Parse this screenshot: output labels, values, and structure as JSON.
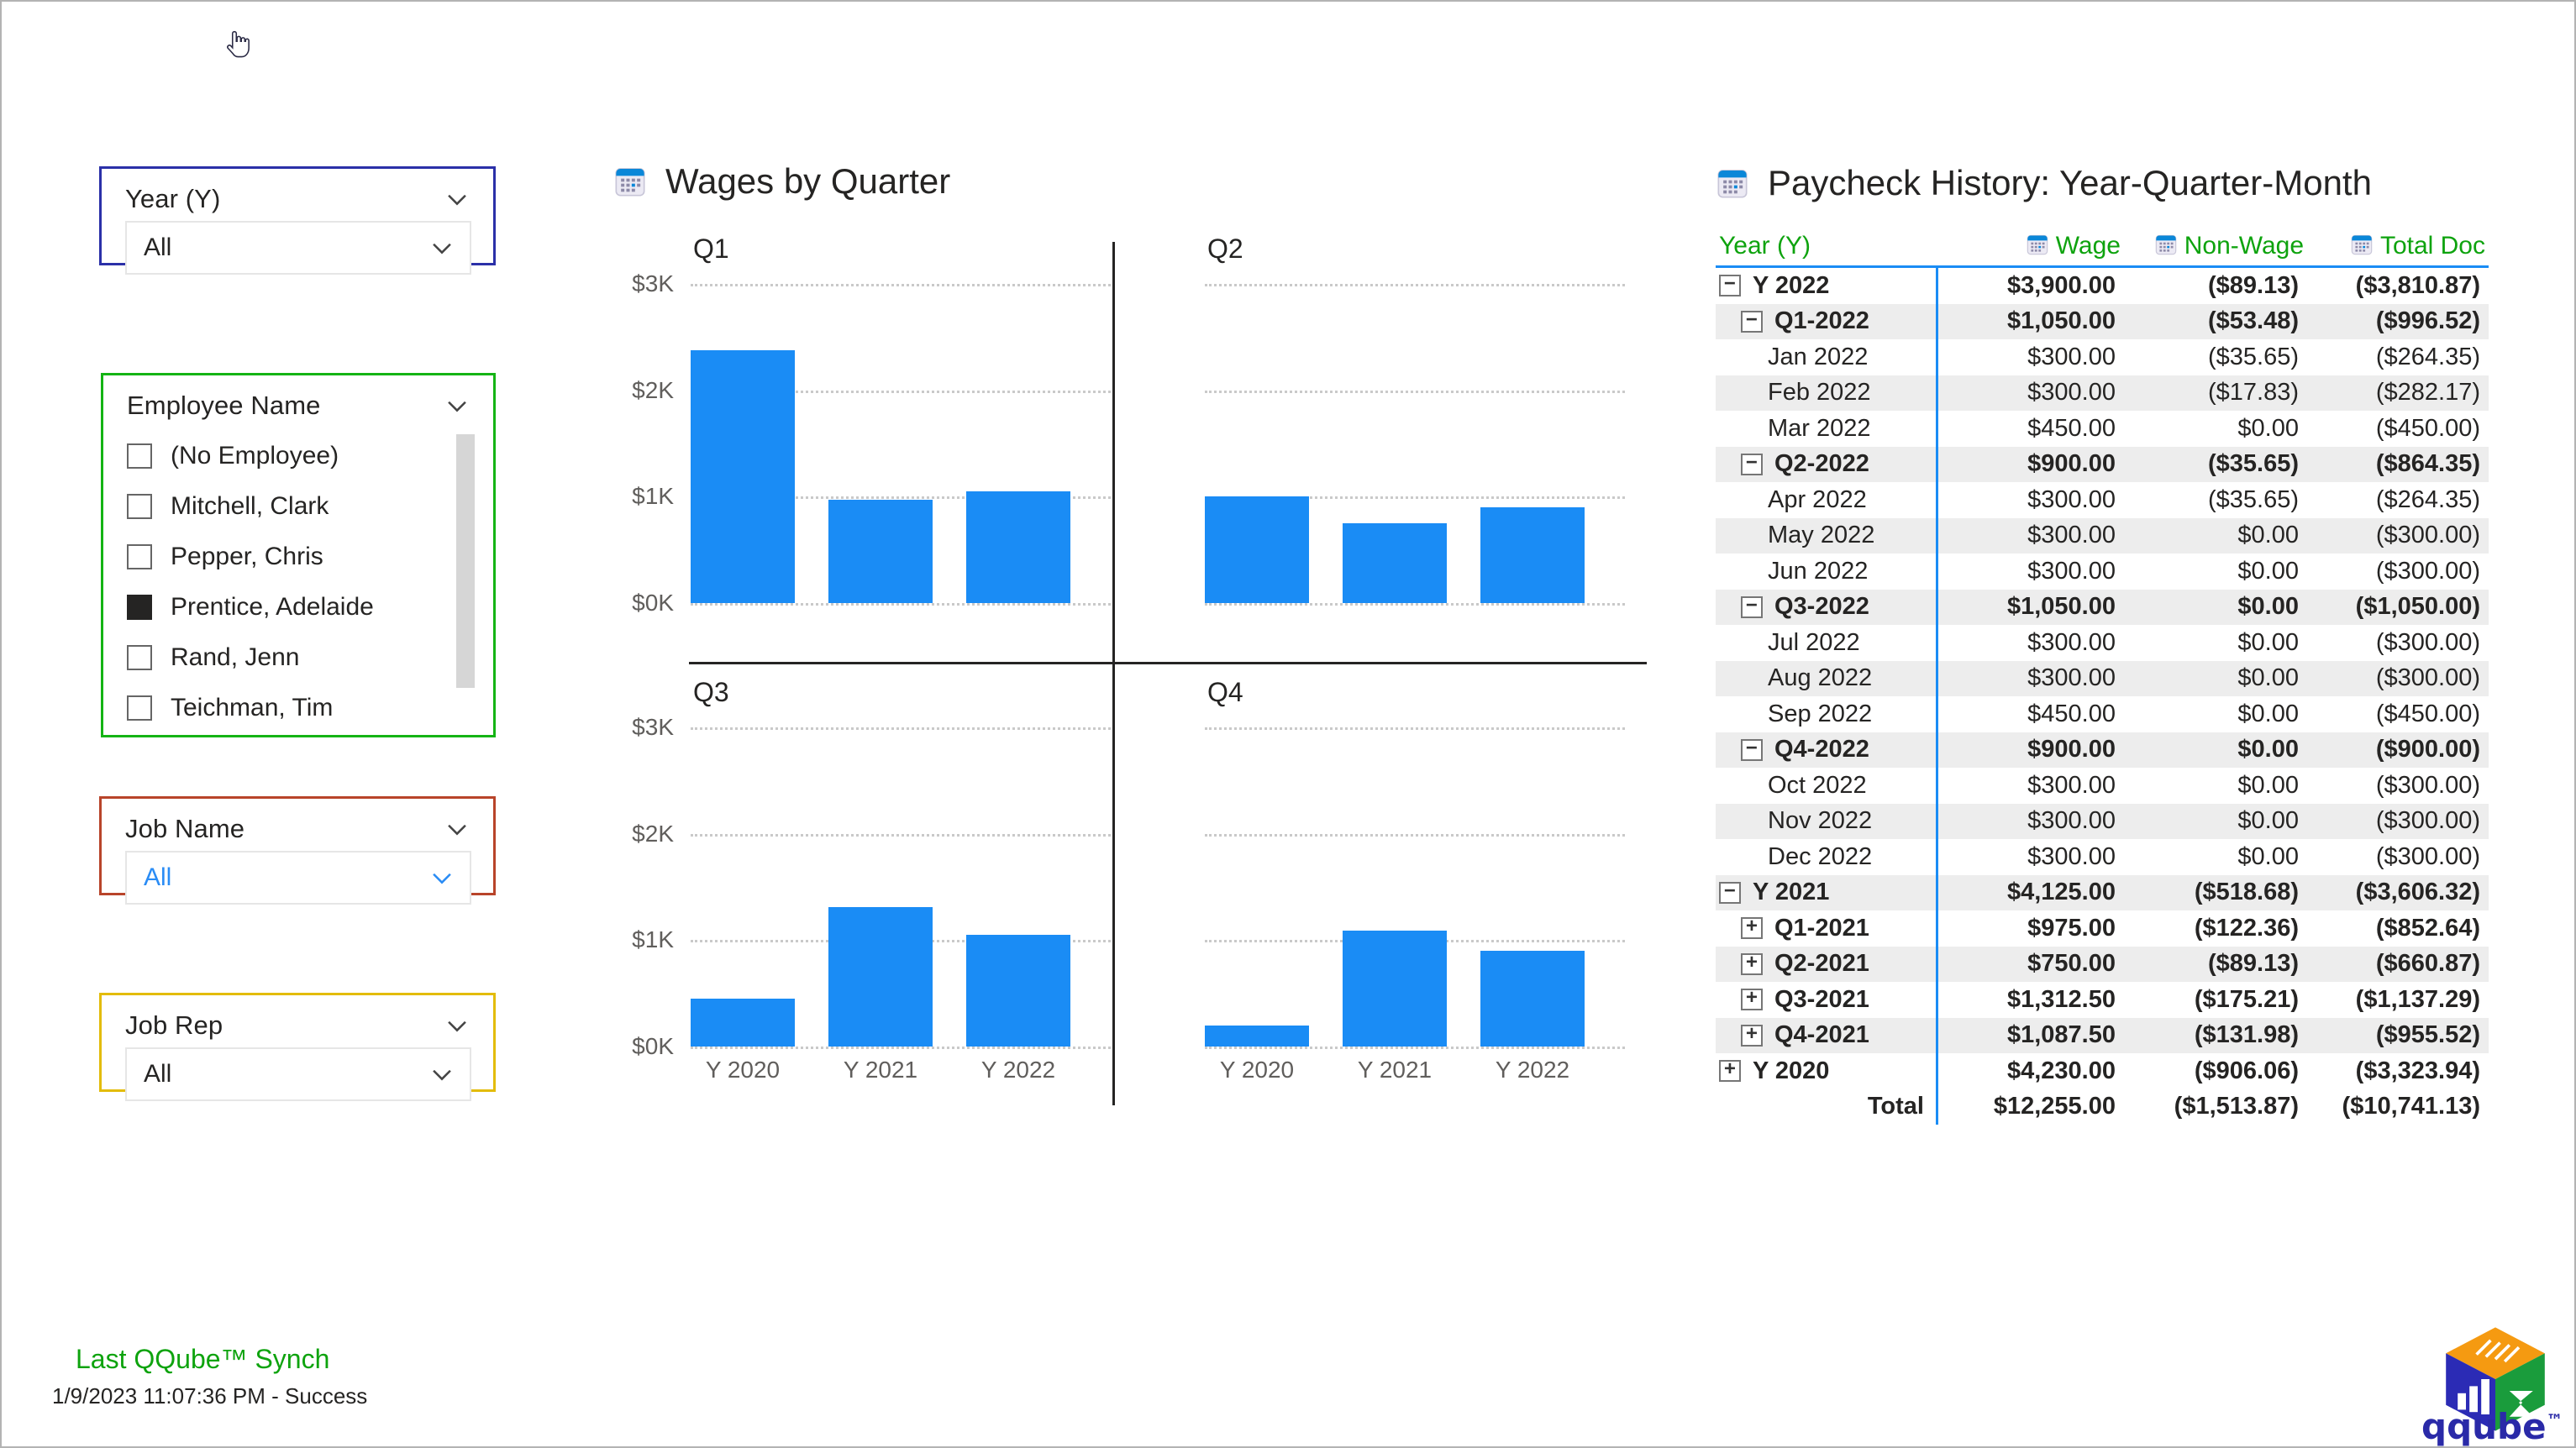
{
  "cursor": {
    "icon": "pointing-hand-cursor"
  },
  "slicers": [
    {
      "id": "year",
      "title": "Year (Y)",
      "value": "All",
      "value_color": "#252423",
      "border_color": "#2b30a8",
      "type": "dropdown"
    },
    {
      "id": "employee",
      "title": "Employee Name",
      "type": "checkbox-list",
      "border_color": "#14b414",
      "items": [
        {
          "label": "(No Employee)",
          "selected": false
        },
        {
          "label": "Mitchell, Clark",
          "selected": false
        },
        {
          "label": "Pepper, Chris",
          "selected": false
        },
        {
          "label": "Prentice, Adelaide",
          "selected": true
        },
        {
          "label": "Rand, Jenn",
          "selected": false
        },
        {
          "label": "Teichman, Tim",
          "selected": false
        }
      ]
    },
    {
      "id": "jobname",
      "title": "Job Name",
      "value": "All",
      "value_color": "#2a8cf5",
      "border_color": "#b8442a",
      "type": "dropdown"
    },
    {
      "id": "jobrep",
      "title": "Job Rep",
      "value": "All",
      "value_color": "#252423",
      "border_color": "#e3bc09",
      "type": "dropdown"
    }
  ],
  "chart_panel": {
    "title": "Wages by Quarter",
    "icon": "calendar-icon"
  },
  "chart_data": {
    "type": "bar",
    "title": "Wages by Quarter",
    "xlabel": "",
    "ylabel": "",
    "ylim": [
      0,
      3000
    ],
    "yticks": [
      "$0K",
      "$1K",
      "$2K",
      "$3K"
    ],
    "ytick_values": [
      0,
      1000,
      2000,
      3000
    ],
    "grid": true,
    "legend": "none",
    "categories": [
      "Y 2020",
      "Y 2021",
      "Y 2022"
    ],
    "panels": [
      {
        "name": "Q1",
        "values": [
          2380,
          975,
          1050
        ]
      },
      {
        "name": "Q2",
        "values": [
          1000,
          750,
          900
        ]
      },
      {
        "name": "Q3",
        "values": [
          450,
          1312.5,
          1050
        ]
      },
      {
        "name": "Q4",
        "values": [
          200,
          1087.5,
          900
        ]
      }
    ],
    "bar_color": "#1a8cf5"
  },
  "table_panel": {
    "title": "Paycheck History: Year-Quarter-Month",
    "icon": "calendar-icon",
    "columns": [
      {
        "label": "Year (Y)",
        "icon": null,
        "align": "left"
      },
      {
        "label": "Wage",
        "icon": "calendar-icon",
        "align": "right"
      },
      {
        "label": "Non-Wage",
        "icon": "calendar-icon",
        "align": "right"
      },
      {
        "label": "Total Doc",
        "icon": "calendar-icon",
        "align": "right"
      }
    ],
    "header_color": "#0ea30e",
    "rows": [
      {
        "indent": 0,
        "expander": "minus",
        "name": "Y 2022",
        "wage": "$3,900.00",
        "nonwage": "($89.13)",
        "total": "($3,810.87)",
        "bold": true,
        "alt": false
      },
      {
        "indent": 1,
        "expander": "minus",
        "name": "Q1-2022",
        "wage": "$1,050.00",
        "nonwage": "($53.48)",
        "total": "($996.52)",
        "bold": true,
        "alt": true
      },
      {
        "indent": 2,
        "expander": null,
        "name": "Jan 2022",
        "wage": "$300.00",
        "nonwage": "($35.65)",
        "total": "($264.35)",
        "bold": false,
        "alt": false
      },
      {
        "indent": 2,
        "expander": null,
        "name": "Feb 2022",
        "wage": "$300.00",
        "nonwage": "($17.83)",
        "total": "($282.17)",
        "bold": false,
        "alt": true
      },
      {
        "indent": 2,
        "expander": null,
        "name": "Mar 2022",
        "wage": "$450.00",
        "nonwage": "$0.00",
        "total": "($450.00)",
        "bold": false,
        "alt": false
      },
      {
        "indent": 1,
        "expander": "minus",
        "name": "Q2-2022",
        "wage": "$900.00",
        "nonwage": "($35.65)",
        "total": "($864.35)",
        "bold": true,
        "alt": true
      },
      {
        "indent": 2,
        "expander": null,
        "name": "Apr 2022",
        "wage": "$300.00",
        "nonwage": "($35.65)",
        "total": "($264.35)",
        "bold": false,
        "alt": false
      },
      {
        "indent": 2,
        "expander": null,
        "name": "May 2022",
        "wage": "$300.00",
        "nonwage": "$0.00",
        "total": "($300.00)",
        "bold": false,
        "alt": true
      },
      {
        "indent": 2,
        "expander": null,
        "name": "Jun 2022",
        "wage": "$300.00",
        "nonwage": "$0.00",
        "total": "($300.00)",
        "bold": false,
        "alt": false
      },
      {
        "indent": 1,
        "expander": "minus",
        "name": "Q3-2022",
        "wage": "$1,050.00",
        "nonwage": "$0.00",
        "total": "($1,050.00)",
        "bold": true,
        "alt": true
      },
      {
        "indent": 2,
        "expander": null,
        "name": "Jul 2022",
        "wage": "$300.00",
        "nonwage": "$0.00",
        "total": "($300.00)",
        "bold": false,
        "alt": false
      },
      {
        "indent": 2,
        "expander": null,
        "name": "Aug 2022",
        "wage": "$300.00",
        "nonwage": "$0.00",
        "total": "($300.00)",
        "bold": false,
        "alt": true
      },
      {
        "indent": 2,
        "expander": null,
        "name": "Sep 2022",
        "wage": "$450.00",
        "nonwage": "$0.00",
        "total": "($450.00)",
        "bold": false,
        "alt": false
      },
      {
        "indent": 1,
        "expander": "minus",
        "name": "Q4-2022",
        "wage": "$900.00",
        "nonwage": "$0.00",
        "total": "($900.00)",
        "bold": true,
        "alt": true
      },
      {
        "indent": 2,
        "expander": null,
        "name": "Oct 2022",
        "wage": "$300.00",
        "nonwage": "$0.00",
        "total": "($300.00)",
        "bold": false,
        "alt": false
      },
      {
        "indent": 2,
        "expander": null,
        "name": "Nov 2022",
        "wage": "$300.00",
        "nonwage": "$0.00",
        "total": "($300.00)",
        "bold": false,
        "alt": true
      },
      {
        "indent": 2,
        "expander": null,
        "name": "Dec 2022",
        "wage": "$300.00",
        "nonwage": "$0.00",
        "total": "($300.00)",
        "bold": false,
        "alt": false
      },
      {
        "indent": 0,
        "expander": "minus",
        "name": "Y 2021",
        "wage": "$4,125.00",
        "nonwage": "($518.68)",
        "total": "($3,606.32)",
        "bold": true,
        "alt": true
      },
      {
        "indent": 1,
        "expander": "plus",
        "name": "Q1-2021",
        "wage": "$975.00",
        "nonwage": "($122.36)",
        "total": "($852.64)",
        "bold": true,
        "alt": false
      },
      {
        "indent": 1,
        "expander": "plus",
        "name": "Q2-2021",
        "wage": "$750.00",
        "nonwage": "($89.13)",
        "total": "($660.87)",
        "bold": true,
        "alt": true
      },
      {
        "indent": 1,
        "expander": "plus",
        "name": "Q3-2021",
        "wage": "$1,312.50",
        "nonwage": "($175.21)",
        "total": "($1,137.29)",
        "bold": true,
        "alt": false
      },
      {
        "indent": 1,
        "expander": "plus",
        "name": "Q4-2021",
        "wage": "$1,087.50",
        "nonwage": "($131.98)",
        "total": "($955.52)",
        "bold": true,
        "alt": true
      },
      {
        "indent": 0,
        "expander": "plus",
        "name": "Y 2020",
        "wage": "$4,230.00",
        "nonwage": "($906.06)",
        "total": "($3,323.94)",
        "bold": true,
        "alt": false
      },
      {
        "indent": 0,
        "expander": null,
        "name": "Total",
        "wage": "$12,255.00",
        "nonwage": "($1,513.87)",
        "total": "($10,741.13)",
        "bold": true,
        "alt": false,
        "is_total": true
      }
    ]
  },
  "footer": {
    "sync_title": "Last QQube™ Synch",
    "sync_status": "1/9/2023 11:07:36 PM - Success",
    "sync_title_color": "#0ea30e",
    "logo_text": "qqube",
    "logo_tm": "™"
  }
}
